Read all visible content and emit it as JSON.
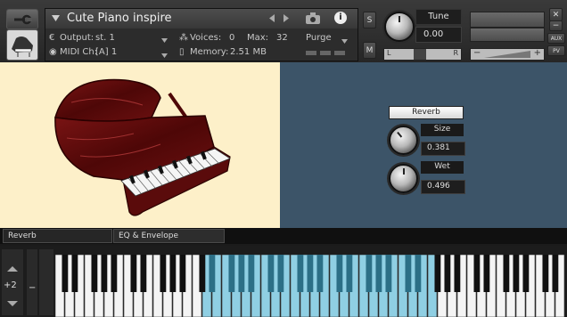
{
  "instrument": {
    "name": "Cute Piano  inspire",
    "output_label": "Output:",
    "output_value": "st. 1",
    "voices_label": "Voices:",
    "voices_value": "0",
    "max_label": "Max:",
    "max_value": "32",
    "purge_label": "Purge",
    "midi_label": "MIDI Ch:",
    "midi_value": "[A]  1",
    "memory_label": "Memory:",
    "memory_value": "2.51 MB"
  },
  "mix": {
    "s_label": "S",
    "m_label": "M",
    "tune_label": "Tune",
    "tune_value": "0.00",
    "pan_left": "L",
    "pan_right": "R",
    "vol_minus": "−",
    "vol_plus": "+",
    "aux_label": "AUX",
    "pv_label": "PV",
    "close_icon_char": "✕",
    "min_icon_char": "−"
  },
  "reverb": {
    "button_label": "Reverb",
    "size_label": "Size",
    "size_value": "0.381",
    "wet_label": "Wet",
    "wet_value": "0.496"
  },
  "tabs": [
    {
      "label": "Reverb"
    },
    {
      "label": "EQ & Envelope"
    }
  ],
  "keyboard": {
    "octave_value": "+2",
    "octave_minus": "−",
    "highlight_color": "#8fcfe3"
  },
  "colors": {
    "panel": "#3c5468",
    "art_bg": "#fdf0c9"
  }
}
